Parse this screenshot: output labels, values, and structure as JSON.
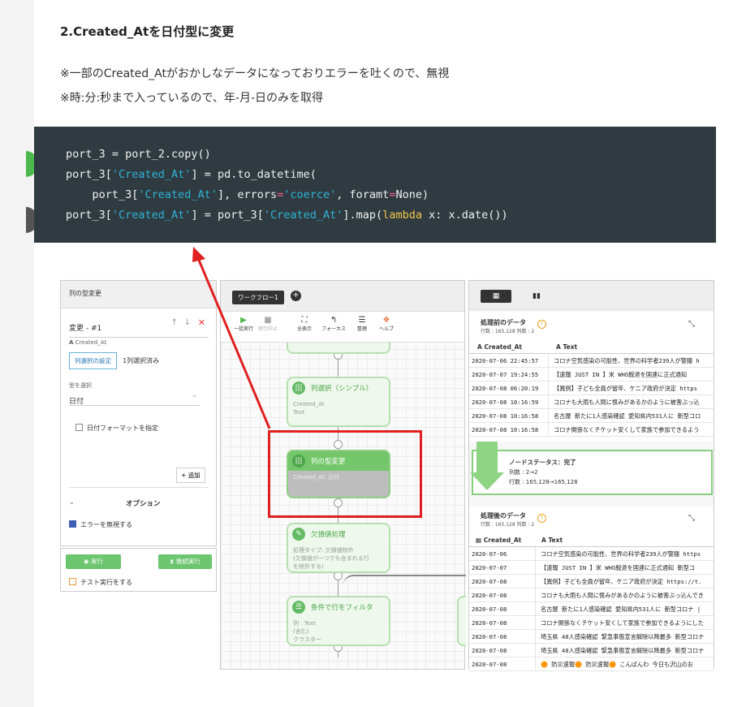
{
  "article": {
    "heading": "2.Created_Atを日付型に変更",
    "note1": "※一部のCreated_Atがおかしなデータになっておりエラーを吐くので、無視",
    "note2": "※時:分:秒まで入っているので、年-月-日のみを取得"
  },
  "code": {
    "l1": "port_3 = port_2.copy()",
    "l2_a": "port_3[",
    "l2_s": "'Created_At'",
    "l2_b": "] = pd.to_datetime(",
    "l3_a": "    port_3[",
    "l3_s": "'Created_At'",
    "l3_b": "], errors",
    "l3_eq": "=",
    "l3_s2": "'coerce'",
    "l3_c": ", foramt",
    "l3_eq2": "=",
    "l3_d": "None)",
    "l4_a": "port_3[",
    "l4_s": "'Created_At'",
    "l4_b": "] = port_3[",
    "l4_s2": "'Created_At'",
    "l4_c": "].map(",
    "l4_kw": "lambda",
    "l4_d": " x: x.date())"
  },
  "left_panel": {
    "title": "列の型変更",
    "change_label": "変更 - #1",
    "column_name": "Created_At",
    "col_select_btn": "列選択の設定",
    "col_selected": "1列選択済み",
    "type_label": "型を選択",
    "type_value": "日付",
    "date_format_label": "日付フォーマットを指定",
    "add_btn": "追加",
    "options_label": "オプション",
    "ignore_errors_label": "エラーを無視する",
    "run_btn": "実行",
    "run_next_btn": "後続実行",
    "test_run_label": "テスト実行をする"
  },
  "workflow": {
    "tab_label": "ワークフロー1",
    "toolbar": [
      "一括実行",
      "実行中止",
      "全表示",
      "フォーカス",
      "整理",
      "ヘルプ"
    ],
    "nodes": [
      {
        "title": "列選択（シンプル）",
        "body": [
          "Created_At",
          "Text"
        ]
      },
      {
        "title": "列の型変更",
        "body": [
          "Created_At: 日付"
        ]
      },
      {
        "title": "欠損値処理",
        "body": [
          "処理タイプ: 欠損値除外",
          "(欠損値が一つでも含まれる行",
          "を除外する)"
        ]
      },
      {
        "title": "条件で行をフィルタ",
        "body": [
          "列 : Text",
          "(含む)",
          "クラスター"
        ]
      }
    ]
  },
  "right_panel": {
    "before_title": "処理前のデータ",
    "before_sub": "行数 : 165,128 列数 : 2",
    "col1": "Created_At",
    "col2": "Text",
    "before_rows": [
      [
        "2020-07-06 22:45:57",
        "コロナ空気感染の可能性、世界の科学者239人が警鐘 h"
      ],
      [
        "2020-07-07 19:24:55",
        "【速報 JUST IN 】米 WHO脱退を国連に正式通知"
      ],
      [
        "2020-07-08 06:20:19",
        "【異例】子ども全員が留年、ケニア政府が決定 https"
      ],
      [
        "2020-07-08 10:16:59",
        "コロナも大雨も人間に恨みがあるかのように被害ぶっ込"
      ],
      [
        "2020-07-08 10:16:58",
        "名古屋 新たに1人感染確認 愛知県内531人に 新型コロ"
      ],
      [
        "2020-07-08 10:16:58",
        "コロナ関係なくチケット安くして家族で参加できるよう"
      ]
    ],
    "status_title": "ノードステータス：完了",
    "status_cols": "列数 : 2→2",
    "status_rows": "行数 : 165,128→165,128",
    "after_title": "処理後のデータ",
    "after_sub": "行数 : 165,128 列数 : 2",
    "after_rows": [
      [
        "2020-07-06",
        "コロナ空気感染の可能性、世界の科学者239人が警鐘 https"
      ],
      [
        "2020-07-07",
        "【速報 JUST IN 】米 WHO脱退を国連に正式通知 新型コ"
      ],
      [
        "2020-07-08",
        "【異例】子ども全員が留年、ケニア政府が決定 https://t."
      ],
      [
        "2020-07-08",
        "コロナも大雨も人間に恨みがあるかのように被害ぶっ込んでき"
      ],
      [
        "2020-07-08",
        "名古屋 新たに1人感染確認 愛知県内531人に 新型コロナ |"
      ],
      [
        "2020-07-08",
        "コロナ関係なくチケット安くして家族で参加できるようにした"
      ],
      [
        "2020-07-08",
        "埼玉県 48人感染確認 緊急事態宣言解除以降最多 新型コロナ"
      ],
      [
        "2020-07-08",
        "埼玉県 48人感染確認 緊急事態宣言解除以降最多 新型コロナ"
      ],
      [
        "2020-07-08",
        "🟠 防災速報🟠 防災速報🟠 こんばんわ 今日も沢山のお"
      ]
    ]
  }
}
